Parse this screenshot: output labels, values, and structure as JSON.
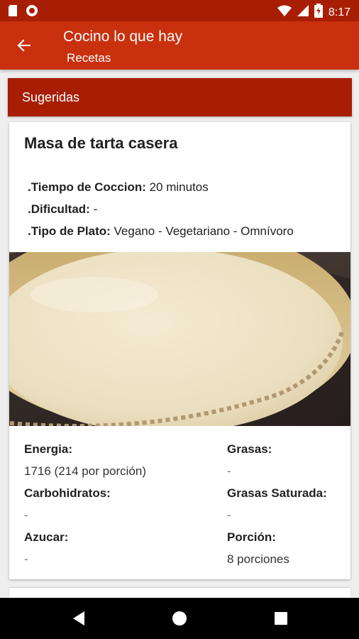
{
  "status_bar": {
    "time": "8:17"
  },
  "app_bar": {
    "title": "Cocino lo que hay",
    "subtitle": "Recetas"
  },
  "section": {
    "title": "Sugeridas"
  },
  "recipe": {
    "title": "Masa de tarta casera",
    "meta": [
      {
        "label": ".Tiempo de Coccion:",
        "value": " 20 minutos"
      },
      {
        "label": ".Dificultad:",
        "value": " -"
      },
      {
        "label": ".Tipo de Plato:",
        "value": " Vegano - Vegetariano - Omnívoro"
      }
    ],
    "nutrition": {
      "energia": {
        "label": "Energia:",
        "value": "1716 (214 por porción)"
      },
      "grasas": {
        "label": "Grasas:",
        "value": "-"
      },
      "carbohidratos": {
        "label": "Carbohidratos:",
        "value": "-"
      },
      "grasas_saturada": {
        "label": "Grasas Saturada:",
        "value": "-"
      },
      "azucar": {
        "label": "Azucar:",
        "value": "-"
      },
      "porcion": {
        "label": "Porción:",
        "value": "8 porciones"
      }
    }
  },
  "colors": {
    "status_bar": "#a81e05",
    "app_bar": "#c9300d",
    "section_header": "#a81e05"
  }
}
